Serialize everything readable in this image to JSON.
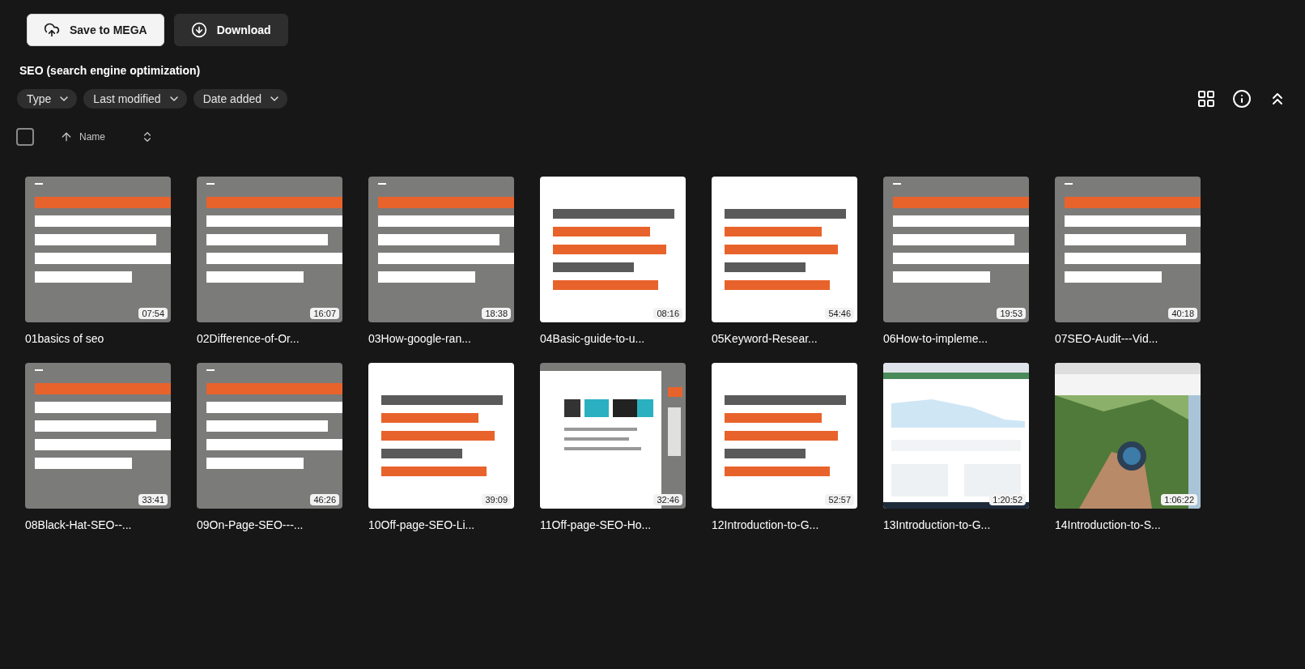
{
  "toolbar": {
    "buttons": [
      {
        "label": "Save to MEGA",
        "kind": "primary"
      },
      {
        "label": "Download",
        "kind": "secondary"
      }
    ]
  },
  "folder_title": "SEO (search engine optimization)",
  "filters": [
    {
      "label": "Type"
    },
    {
      "label": "Last modified"
    },
    {
      "label": "Date added"
    }
  ],
  "list_header": {
    "select_all": {
      "checked": false
    },
    "sort_column": "Name"
  },
  "files": [
    {
      "name": "01basics of seo",
      "duration": "07:54"
    },
    {
      "name": "02Difference-of-Or...",
      "duration": "16:07"
    },
    {
      "name": "03How-google-ran...",
      "duration": "18:38"
    },
    {
      "name": "04Basic-guide-to-u...",
      "duration": "08:16"
    },
    {
      "name": "05Keyword-Resear...",
      "duration": "54:46"
    },
    {
      "name": "06How-to-impleme...",
      "duration": "19:53"
    },
    {
      "name": "07SEO-Audit---Vid...",
      "duration": "40:18"
    },
    {
      "name": "08Black-Hat-SEO--...",
      "duration": "33:41"
    },
    {
      "name": "09On-Page-SEO---...",
      "duration": "46:26"
    },
    {
      "name": "10Off-page-SEO-Li...",
      "duration": "39:09"
    },
    {
      "name": "11Off-page-SEO-Ho...",
      "duration": "32:46"
    },
    {
      "name": "12Introduction-to-G...",
      "duration": "52:57"
    },
    {
      "name": "13Introduction-to-G...",
      "duration": "1:20:52"
    },
    {
      "name": "14Introduction-to-S...",
      "duration": "1:06:22"
    }
  ]
}
